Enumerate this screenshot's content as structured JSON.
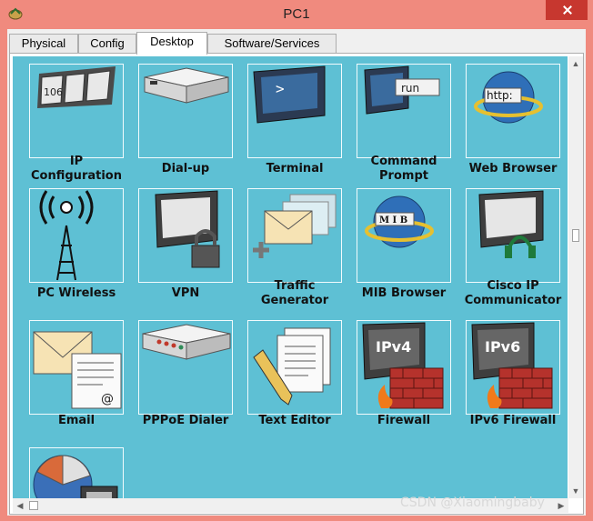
{
  "window": {
    "title": "PC1"
  },
  "tabs": [
    {
      "label": "Physical"
    },
    {
      "label": "Config"
    },
    {
      "label": "Desktop"
    },
    {
      "label": "Software/Services"
    }
  ],
  "apps": [
    {
      "label_line1": "IP",
      "label_line2": "Configuration",
      "icon_text": "106"
    },
    {
      "label_line1": "Dial-up",
      "label_line2": ""
    },
    {
      "label_line1": "Terminal",
      "label_line2": "",
      "icon_text": ">"
    },
    {
      "label_line1": "Command",
      "label_line2": "Prompt",
      "icon_text": "run"
    },
    {
      "label_line1": "Web Browser",
      "label_line2": "",
      "icon_text": "http:"
    },
    {
      "label_line1": "PC Wireless",
      "label_line2": ""
    },
    {
      "label_line1": "VPN",
      "label_line2": ""
    },
    {
      "label_line1": "Traffic",
      "label_line2": "Generator"
    },
    {
      "label_line1": "MIB Browser",
      "label_line2": "",
      "icon_text": "M I B"
    },
    {
      "label_line1": "Cisco IP",
      "label_line2": "Communicator"
    },
    {
      "label_line1": "Email",
      "label_line2": "",
      "icon_text": "@"
    },
    {
      "label_line1": "PPPoE Dialer",
      "label_line2": ""
    },
    {
      "label_line1": "Text Editor",
      "label_line2": ""
    },
    {
      "label_line1": "Firewall",
      "label_line2": "",
      "icon_text": "IPv4"
    },
    {
      "label_line1": "IPv6 Firewall",
      "label_line2": "",
      "icon_text": "IPv6"
    },
    {
      "label_line1": "",
      "label_line2": ""
    }
  ],
  "watermark": "CSDN @Xiaomingbaby"
}
